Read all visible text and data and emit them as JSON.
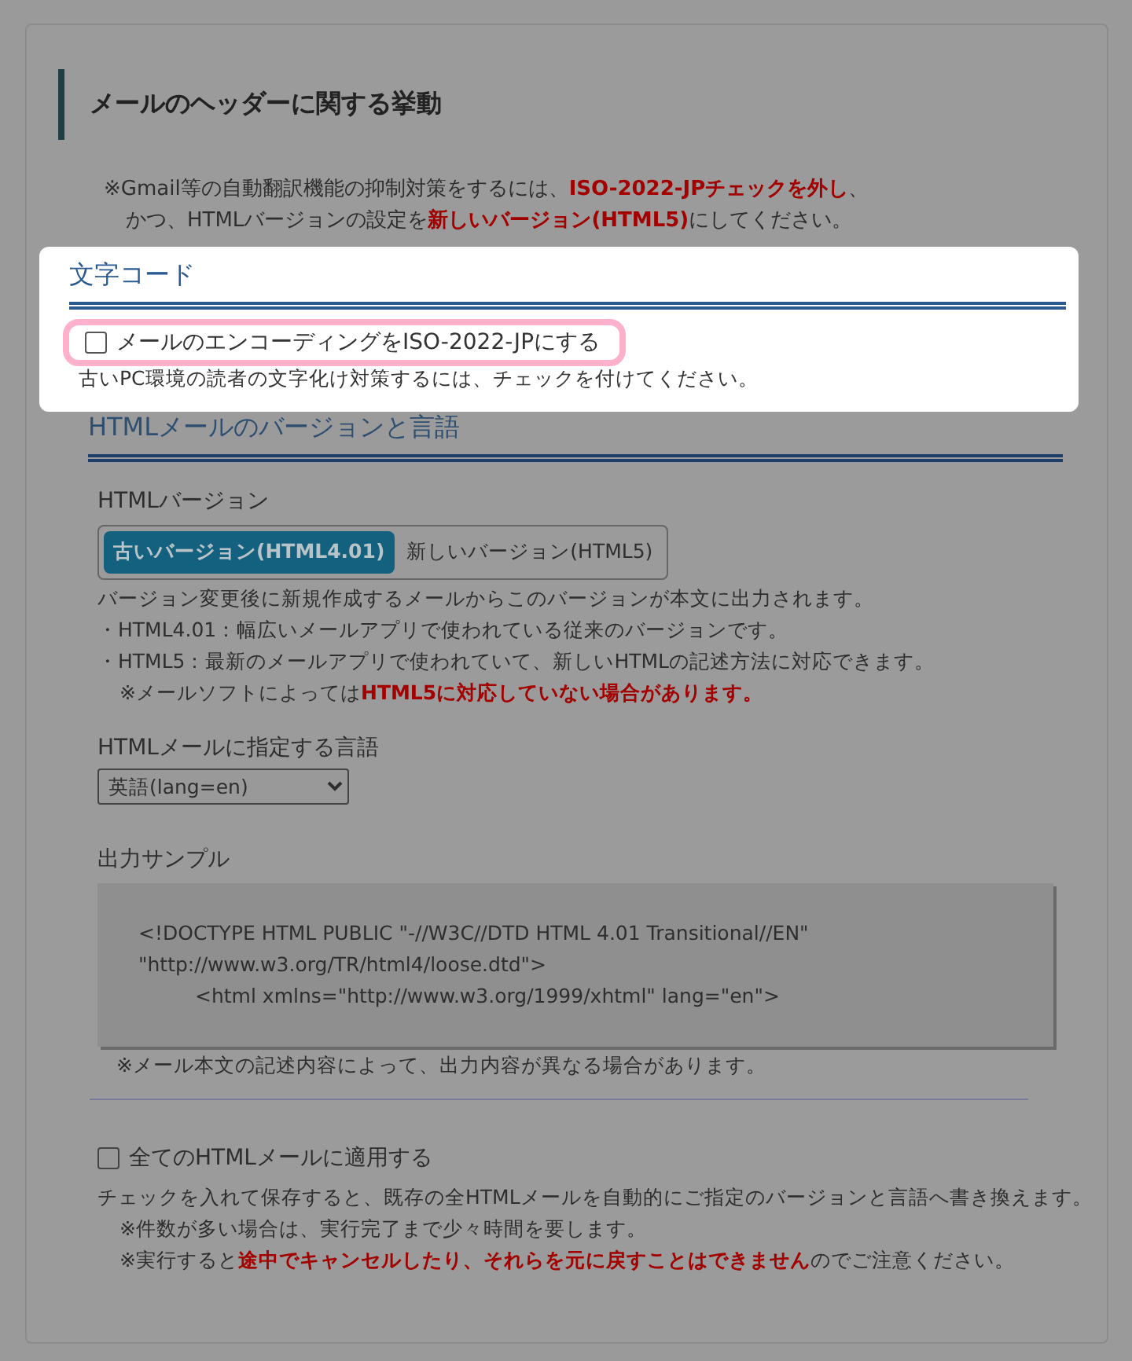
{
  "header": {
    "title": "メールのヘッダーに関する挙動"
  },
  "notice": {
    "lines": [
      "※Gmail等の自動翻訳機能の抑制対策をするには、**ISO-2022-JPチェックを外し**、",
      "かつ、HTMLバージョンの設定を**新しいバージョン(HTML5)**にしてください。"
    ]
  },
  "charset": {
    "title": "文字コード",
    "checkbox": {
      "label": "メールのエンコーディングをISO-2022-JPにする",
      "checked": false,
      "highlighted": true
    },
    "help": "古いPC環境の読者の文字化け対策するには、チェックを付けてください。"
  },
  "html_section": {
    "title": "HTMLメールのバージョンと言語",
    "version": {
      "label": "HTMLバージョン",
      "options": [
        {
          "label": "古いバージョン(HTML4.01)",
          "selected": true
        },
        {
          "label": "新しいバージョン(HTML5)",
          "selected": false
        }
      ],
      "notes": [
        {
          "kind": "plain",
          "text": "バージョン変更後に新規作成するメールからこのバージョンが本文に出力されます。"
        },
        {
          "kind": "plain",
          "text": "・HTML4.01：幅広いメールアプリで使われている従来のバージョンです。"
        },
        {
          "kind": "plain",
          "text": "・HTML5：最新のメールアプリで使われていて、新しいHTMLの記述方法に対応できます。"
        },
        {
          "kind": "indent",
          "text": "※メールソフトによっては**HTML5に対応していない場合があります。**"
        }
      ]
    },
    "language": {
      "label": "HTMLメールに指定する言語",
      "value": "英語(lang=en)"
    },
    "sample": {
      "label": "出力サンプル",
      "code": [
        {
          "kind": "plain",
          "text": "<!DOCTYPE HTML PUBLIC \"-//W3C//DTD HTML 4.01 Transitional//EN\""
        },
        {
          "kind": "plain",
          "text": "\"http://www.w3.org/TR/html4/loose.dtd\">"
        },
        {
          "kind": "indent",
          "text": "<html xmlns=\"http://www.w3.org/1999/xhtml\" lang=\"en\">"
        }
      ],
      "note": "※メール本文の記述内容によって、出力内容が異なる場合があります。"
    }
  },
  "apply_all": {
    "checkbox": {
      "label": "全てのHTMLメールに適用する",
      "checked": false
    },
    "notes": [
      {
        "kind": "plain",
        "text": "チェックを入れて保存すると、既存の全HTMLメールを自動的にご指定のバージョンと言語へ書き換えます。"
      },
      {
        "kind": "indent",
        "text": "※件数が多い場合は、実行完了まで少々時間を要します。"
      },
      {
        "kind": "indent",
        "text": "※実行すると**途中でキャンセルしたり、それらを元に戻すことはできません**のでご注意ください。"
      }
    ]
  }
}
